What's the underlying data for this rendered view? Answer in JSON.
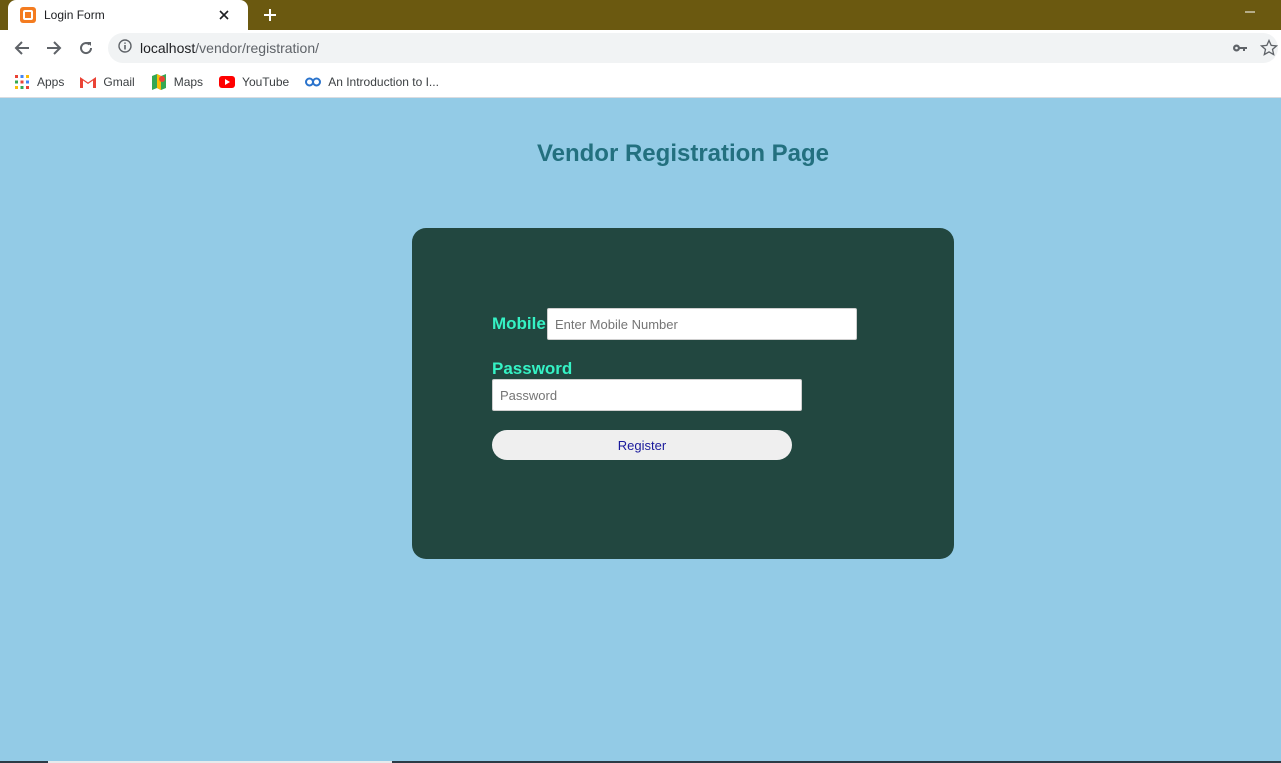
{
  "browser": {
    "tab_title": "Login Form",
    "url_host": "localhost",
    "url_path": "/vendor/registration/",
    "bookmarks": [
      {
        "label": "Apps",
        "icon": "apps-grid-icon"
      },
      {
        "label": "Gmail",
        "icon": "gmail-icon"
      },
      {
        "label": "Maps",
        "icon": "maps-icon"
      },
      {
        "label": "YouTube",
        "icon": "youtube-icon"
      },
      {
        "label": "An Introduction to I...",
        "icon": "coursera-icon"
      }
    ]
  },
  "page": {
    "title": "Vendor Registration Page",
    "form": {
      "mobile_label": "Mobile",
      "mobile_placeholder": "Enter Mobile Number",
      "password_label": "Password",
      "password_placeholder": "Password",
      "register_label": "Register"
    }
  },
  "colors": {
    "page_background": "#93cbe6",
    "card_background": "#224740",
    "label_color": "#35f2c5",
    "title_color": "#23707f",
    "tabstrip": "#6b5910"
  }
}
